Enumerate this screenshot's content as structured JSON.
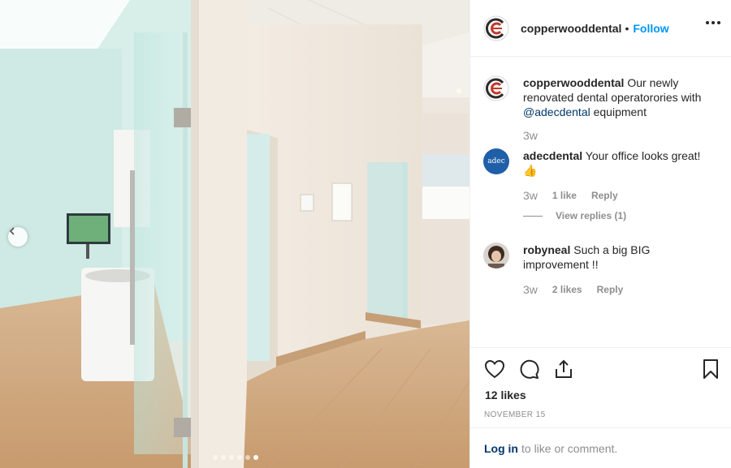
{
  "post": {
    "author": "copperwooddental",
    "follow_separator": "•",
    "follow_label": "Follow",
    "photo": {
      "dots_count": 6,
      "active_dot": 5
    }
  },
  "comments": [
    {
      "user": "copperwooddental",
      "text_before": " Our newly renovated dental operatorories with ",
      "mention": "@adecdental",
      "text_after": " equipment",
      "age": "3w"
    },
    {
      "user": "adecdental",
      "text": " Your office looks great!",
      "emoji": "👍",
      "age": "3w",
      "likes": "1 like",
      "reply": "Reply",
      "view_replies": "View replies (1)",
      "avatar_text": "adec"
    },
    {
      "user": "robyneal",
      "text": " Such a big BIG improvement !!",
      "age": "3w",
      "likes": "2 likes",
      "reply": "Reply"
    }
  ],
  "stats": {
    "likes": "12 likes",
    "date": "NOVEMBER 15"
  },
  "login_bar": {
    "login_label": "Log in",
    "rest": "to like or comment."
  },
  "icons": {
    "like": "heart-icon",
    "comment": "comment-icon",
    "share": "share-icon",
    "save": "bookmark-icon",
    "more": "more-dots-icon",
    "prev": "chevron-left-icon"
  },
  "colors": {
    "link_blue": "#0095f6",
    "mention": "#00376b",
    "muted": "#8e8e8e",
    "brand_red": "#c0392b",
    "adec_blue": "#1f5fa8"
  }
}
